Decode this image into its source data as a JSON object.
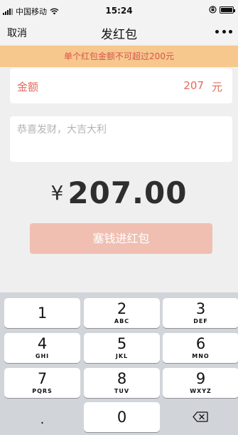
{
  "status_bar": {
    "carrier": "中国移动",
    "time": "15:24"
  },
  "nav": {
    "cancel_label": "取消",
    "title": "发红包"
  },
  "warning_text": "单个红包金额不可超过200元",
  "amount": {
    "label": "金额",
    "value": "207",
    "unit": "元"
  },
  "greeting": {
    "placeholder": "恭喜发财，大吉大利"
  },
  "total": {
    "currency": "¥",
    "value": "207.00"
  },
  "submit_label": "塞钱进红包",
  "keypad": {
    "keys": [
      {
        "num": "1",
        "letters": ""
      },
      {
        "num": "2",
        "letters": "ABC"
      },
      {
        "num": "3",
        "letters": "DEF"
      },
      {
        "num": "4",
        "letters": "GHI"
      },
      {
        "num": "5",
        "letters": "JKL"
      },
      {
        "num": "6",
        "letters": "MNO"
      },
      {
        "num": "7",
        "letters": "PQRS"
      },
      {
        "num": "8",
        "letters": "TUV"
      },
      {
        "num": "9",
        "letters": "WXYZ"
      },
      {
        "num": ".",
        "letters": ""
      },
      {
        "num": "0",
        "letters": ""
      }
    ],
    "backspace_icon": "backspace-icon"
  },
  "colors": {
    "warning_bg": "#f6c88d",
    "warning_text": "#d9534f",
    "accent_red": "#e06b5a",
    "submit_disabled": "#f0bfb2"
  }
}
